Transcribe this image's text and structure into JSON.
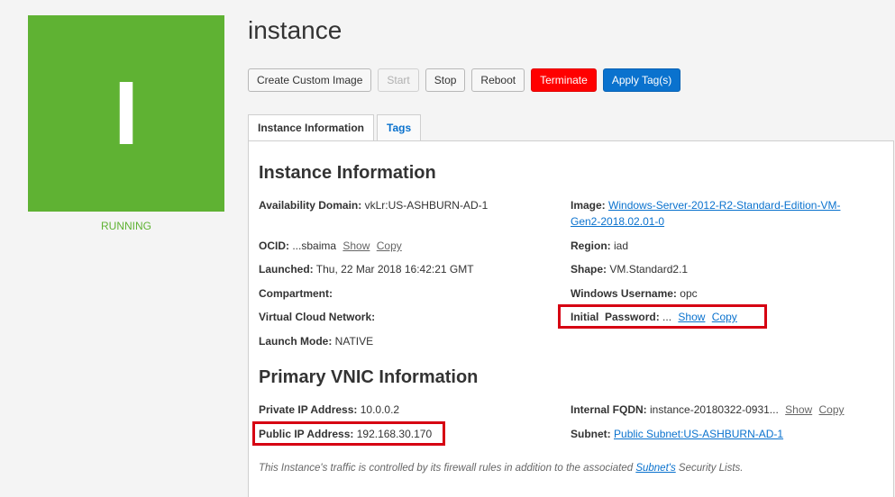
{
  "instance": {
    "letter": "I",
    "name": "instance",
    "status": "RUNNING",
    "status_color": "#5fb233"
  },
  "toolbar": {
    "create_custom_image": "Create Custom Image",
    "start": "Start",
    "stop": "Stop",
    "reboot": "Reboot",
    "terminate": "Terminate",
    "apply_tags": "Apply Tag(s)"
  },
  "tabs": [
    "Instance Information",
    "Tags"
  ],
  "instance_info": {
    "heading": "Instance Information",
    "availability_domain": {
      "label": "Availability Domain:",
      "value": "vkLr:US-ASHBURN-AD-1"
    },
    "image": {
      "label": "Image:",
      "value_line1": "Windows-Server-2012-R2-Standard-Edition-VM-",
      "value_line2": "Gen2-2018.02.01-0"
    },
    "ocid": {
      "label": "OCID:",
      "value": "...sbaima",
      "show": "Show",
      "copy": "Copy"
    },
    "region": {
      "label": "Region:",
      "value": "iad"
    },
    "launched": {
      "label": "Launched:",
      "value": "Thu, 22 Mar 2018 16:42:21 GMT"
    },
    "shape": {
      "label": "Shape:",
      "value": "VM.Standard2.1"
    },
    "compartment": {
      "label": "Compartment:",
      "value": ""
    },
    "windows_username": {
      "label": "Windows Username:",
      "value": "opc"
    },
    "vcn": {
      "label": "Virtual Cloud Network:",
      "value": ""
    },
    "initial_password": {
      "label": "Initial  Password:",
      "value": "...",
      "show": "Show",
      "copy": "Copy"
    },
    "launch_mode": {
      "label": "Launch Mode:",
      "value": "NATIVE"
    }
  },
  "vnic_info": {
    "heading": "Primary VNIC Information",
    "private_ip": {
      "label": "Private IP Address:",
      "value": "10.0.0.2"
    },
    "internal_fqdn": {
      "label": "Internal FQDN:",
      "value": "instance-20180322-0931...",
      "show": "Show",
      "copy": "Copy"
    },
    "public_ip": {
      "label": "Public IP Address:",
      "value": "192.168.30.170"
    },
    "subnet": {
      "label": "Subnet:",
      "value": "Public Subnet:US-ASHBURN-AD-1"
    },
    "note_before": "This Instance's traffic is controlled by its firewall rules in addition to the associated ",
    "note_link": "Subnet's",
    "note_after": " Security Lists."
  },
  "colors": {
    "accent": "#0a72ce",
    "danger": "#ff0000",
    "highlight": "#d60012",
    "tile": "#5fb233"
  }
}
